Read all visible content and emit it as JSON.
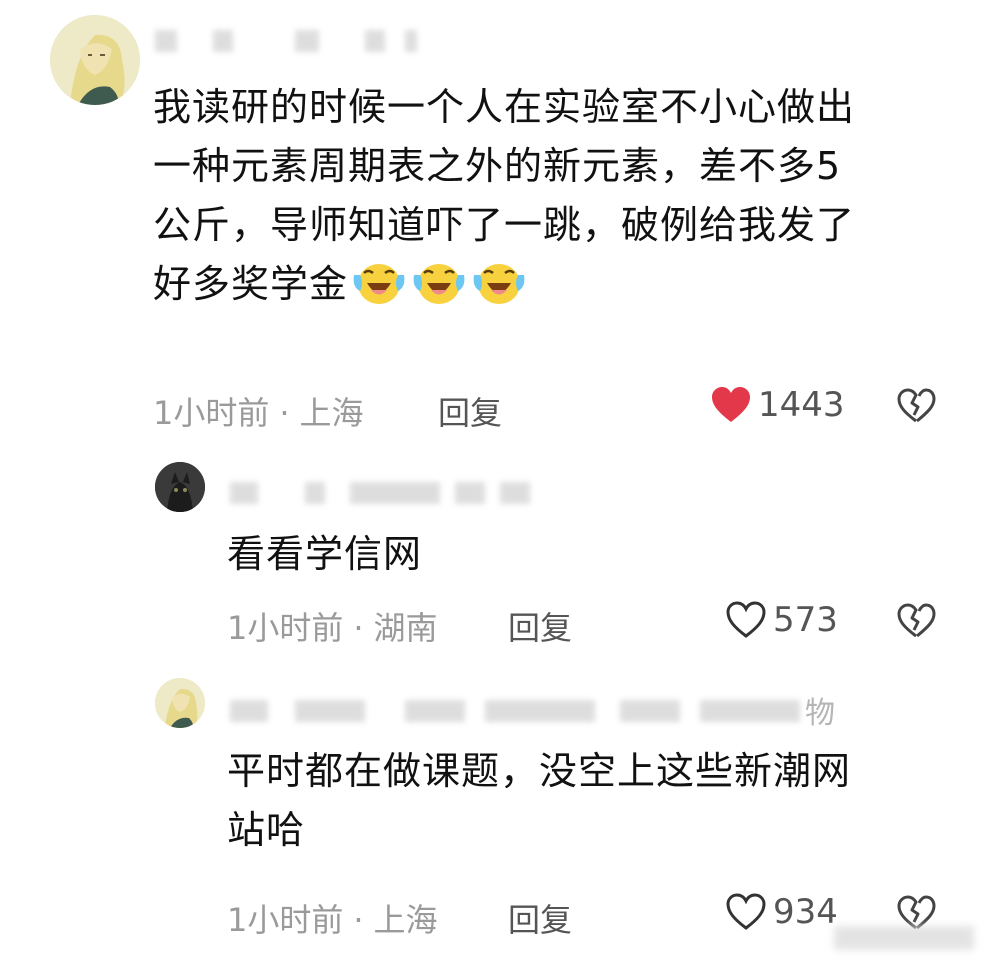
{
  "comments": [
    {
      "text_lines": [
        "我读研的时候一个人在实验室不小心做出",
        "一种元素周期表之外的新元素，差不多5",
        "公斤，导师知道吓了一跳，破例给我发了",
        "好多奖学金"
      ],
      "emoji_count": 3,
      "emoji": "laugh-cry",
      "time": "1小时前",
      "location": "上海",
      "reply_label": "回复",
      "likes": "1443",
      "liked": true
    },
    {
      "text_lines": [
        "看看学信网"
      ],
      "time": "1小时前",
      "location": "湖南",
      "reply_label": "回复",
      "likes": "573",
      "liked": false
    },
    {
      "name_fragment": "物",
      "text_lines": [
        "平时都在做课题，没空上这些新潮网",
        "站哈"
      ],
      "time": "1小时前",
      "location": "上海",
      "reply_label": "回复",
      "likes": "934",
      "liked": false
    }
  ],
  "meta_separator": "·",
  "colors": {
    "like_active": "#e3384a",
    "meta_text": "#9a9a9a",
    "body_text": "#111111"
  },
  "icons": [
    "heart-icon",
    "broken-heart-icon",
    "laugh-cry-emoji-icon"
  ]
}
